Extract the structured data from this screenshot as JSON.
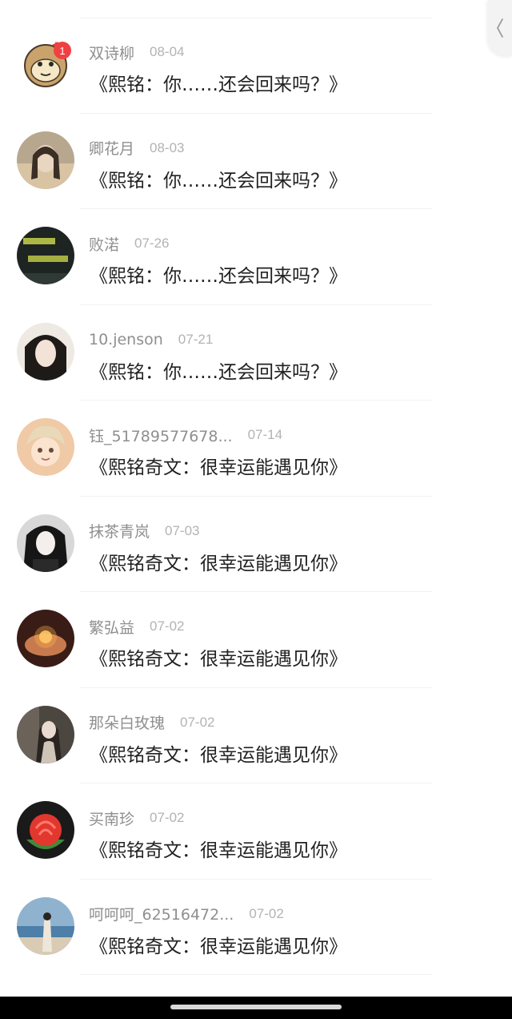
{
  "side_handle": {
    "icon": "chevron-left-icon",
    "glyph": "〈"
  },
  "items": [
    {
      "name": "双诗柳",
      "date": "08-04",
      "title": "《熙铭：你……还会回来吗？》",
      "badge": "1",
      "avatar": "cartoon-monkey"
    },
    {
      "name": "卿花月",
      "date": "08-03",
      "title": "《熙铭：你……还会回来吗？》",
      "avatar": "girl-photo"
    },
    {
      "name": "败渃",
      "date": "07-26",
      "title": "《熙铭：你……还会回来吗？》",
      "avatar": "dark-text-graphic"
    },
    {
      "name": "10.jenson",
      "date": "07-21",
      "title": "《熙铭：你……还会回来吗？》",
      "avatar": "girl-dark-hair"
    },
    {
      "name": "钰_51789577678...",
      "date": "07-14",
      "title": "《熙铭奇文：很幸运能遇见你》",
      "avatar": "anime-boy"
    },
    {
      "name": "抹茶青岚",
      "date": "07-03",
      "title": "《熙铭奇文：很幸运能遇见你》",
      "avatar": "girl-black-white"
    },
    {
      "name": "繁弘益",
      "date": "07-02",
      "title": "《熙铭奇文：很幸运能遇见你》",
      "avatar": "hands-light"
    },
    {
      "name": "那朵白玫瑰",
      "date": "07-02",
      "title": "《熙铭奇文：很幸运能遇见你》",
      "avatar": "girl-traditional"
    },
    {
      "name": "买南珍",
      "date": "07-02",
      "title": "《熙铭奇文：很幸运能遇见你》",
      "avatar": "watermelon-rose"
    },
    {
      "name": "呵呵呵_62516472...",
      "date": "07-02",
      "title": "《熙铭奇文：很幸运能遇见你》",
      "avatar": "beach-figure"
    }
  ],
  "colors": {
    "name": "#8f8f8f",
    "date": "#b3b3b3",
    "title": "#222222",
    "badge": "#f04142",
    "divider": "#f1f1f1"
  }
}
